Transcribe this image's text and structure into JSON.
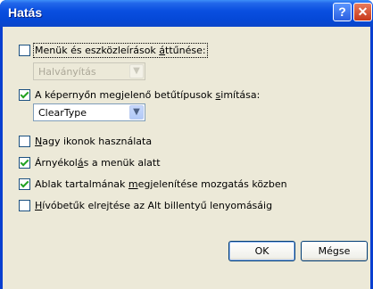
{
  "window": {
    "title": "Hatás",
    "help_label": "?",
    "close_label": "✕"
  },
  "options": [
    {
      "label_pre": "Menük és eszközleírások ",
      "label_u": "á",
      "label_post": "ttűnése:",
      "checked": false
    },
    {
      "label_pre": "A képernyőn megjelenő betűtípusok ",
      "label_u": "s",
      "label_post": "imítása:",
      "checked": true
    },
    {
      "label_pre": "",
      "label_u": "N",
      "label_post": "agy ikonok használata",
      "checked": false
    },
    {
      "label_pre": "Árnyékol",
      "label_u": "á",
      "label_post": "s a menük alatt",
      "checked": true
    },
    {
      "label_pre": "Ablak tartalmának ",
      "label_u": "m",
      "label_post": "egjelenítése mozgatás közben",
      "checked": true
    },
    {
      "label_pre": "",
      "label_u": "H",
      "label_post": "ívóbetűk elrejtése az Alt billentyű lenyomásáig",
      "checked": false
    }
  ],
  "dropdowns": {
    "transition_effect": {
      "value": "Halványítás",
      "enabled": false
    },
    "smoothing_method": {
      "value": "ClearType",
      "enabled": true
    }
  },
  "buttons": {
    "ok_label": "OK",
    "cancel_label": "Mégse"
  },
  "colors": {
    "titlebar": "#0548d6",
    "dialog_bg": "#ece9d8",
    "checkmark": "#21a121"
  }
}
